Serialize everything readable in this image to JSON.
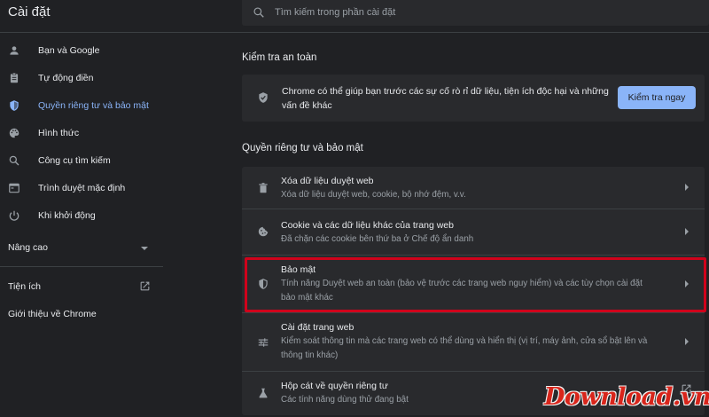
{
  "app": {
    "title": "Cài đặt"
  },
  "search": {
    "placeholder": "Tìm kiếm trong phần cài đặt",
    "icon": "search-icon"
  },
  "sidebar": {
    "items": [
      {
        "label": "Bạn và Google",
        "icon": "person-icon",
        "active": false
      },
      {
        "label": "Tự động điền",
        "icon": "clipboard-icon",
        "active": false
      },
      {
        "label": "Quyền riêng tư và bảo mật",
        "icon": "shield-icon",
        "active": true
      },
      {
        "label": "Hình thức",
        "icon": "palette-icon",
        "active": false
      },
      {
        "label": "Công cụ tìm kiếm",
        "icon": "search-icon",
        "active": false
      },
      {
        "label": "Trình duyệt mặc định",
        "icon": "browser-icon",
        "active": false
      },
      {
        "label": "Khi khởi động",
        "icon": "power-icon",
        "active": false
      }
    ],
    "advanced_label": "Nâng cao",
    "extensions_label": "Tiện ích",
    "about_label": "Giới thiệu về Chrome"
  },
  "safety_check": {
    "section_title": "Kiểm tra an toàn",
    "description": "Chrome có thể giúp bạn trước các sự cố rò rỉ dữ liệu, tiện ích độc hại và những vấn đề khác",
    "button_label": "Kiểm tra ngay"
  },
  "privacy": {
    "section_title": "Quyền riêng tư và bảo mật",
    "rows": [
      {
        "title": "Xóa dữ liệu duyệt web",
        "desc": "Xóa dữ liệu duyệt web, cookie, bộ nhớ đệm, v.v.",
        "icon": "trash-icon"
      },
      {
        "title": "Cookie và các dữ liệu khác của trang web",
        "desc": "Đã chặn các cookie bên thứ ba ở Chế độ ẩn danh",
        "icon": "cookie-icon"
      },
      {
        "title": "Bảo mật",
        "desc": "Tính năng Duyệt web an toàn (bảo vệ trước các trang web nguy hiểm) và các tùy chọn cài đặt bảo mật khác",
        "icon": "security-shield-icon"
      },
      {
        "title": "Cài đặt trang web",
        "desc": "Kiểm soát thông tin mà các trang web có thể dùng và hiển thị (vị trí, máy ảnh, cửa sổ bật lên và thông tin khác)",
        "icon": "sliders-icon"
      },
      {
        "title": "Hộp cát về quyền riêng tư",
        "desc": "Các tính năng dùng thử đang bật",
        "icon": "flask-icon"
      }
    ]
  },
  "watermark": {
    "text": "Download.vn"
  },
  "colors": {
    "background": "#202124",
    "card": "#292a2d",
    "accent": "#8ab4f8",
    "highlight": "#d0021b"
  }
}
